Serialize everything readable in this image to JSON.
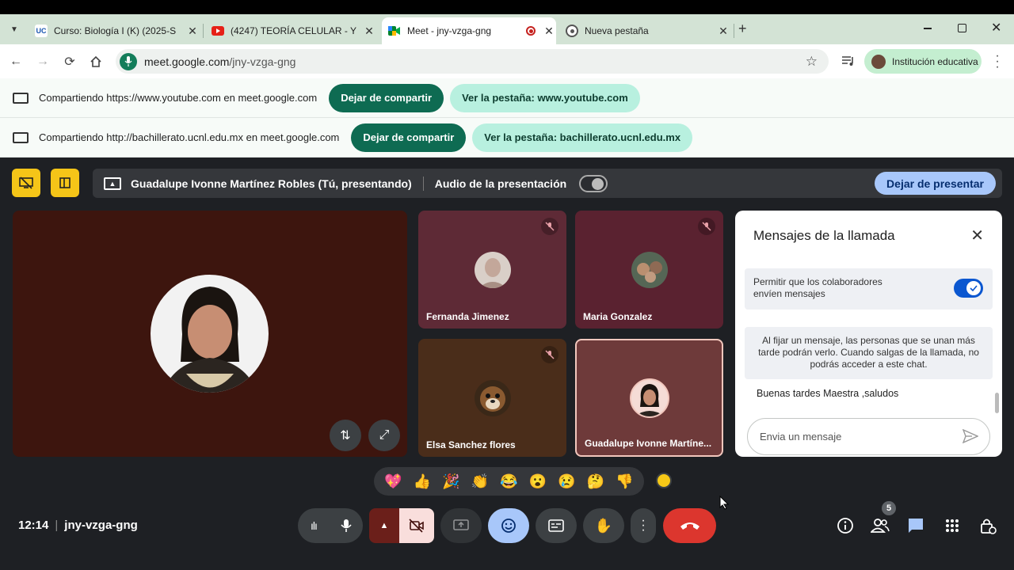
{
  "browser": {
    "tabs": [
      {
        "title": "Curso: Biología I (K) (2025-S",
        "favicon": "uc-logo-icon",
        "active": false
      },
      {
        "title": "(4247) TEORÍA CELULAR - Y",
        "favicon": "youtube-icon",
        "active": false
      },
      {
        "title": "Meet - jny-vzga-gng",
        "favicon": "meet-icon",
        "active": true
      },
      {
        "title": "Nueva pestaña",
        "favicon": "chrome-icon",
        "active": false
      }
    ],
    "url_host": "meet.google.com",
    "url_path": "/jny-vzga-gng",
    "profile_label": "Institución educativa"
  },
  "share_bars": [
    {
      "text": "Compartiendo https://www.youtube.com en meet.google.com",
      "stop_label": "Dejar de compartir",
      "view_label": "Ver la pestaña: www.youtube.com"
    },
    {
      "text": "Compartiendo http://bachillerato.ucnl.edu.mx en meet.google.com",
      "stop_label": "Dejar de compartir",
      "view_label": "Ver la pestaña: bachillerato.ucnl.edu.mx"
    }
  ],
  "meet": {
    "presenter_text": "Guadalupe Ivonne Martínez Robles (Tú, presentando)",
    "audio_label": "Audio de la presentación",
    "stop_presenting_label": "Dejar de presentar",
    "participants": [
      {
        "name": "Fernanda Jimenez",
        "muted": true,
        "bg": "#5e2a36"
      },
      {
        "name": "Maria Gonzalez",
        "muted": true,
        "bg": "#5a2230"
      },
      {
        "name": "Elsa Sanchez flores",
        "muted": true,
        "bg": "#4a2d1a"
      },
      {
        "name": "Guadalupe Ivonne Martíne...",
        "muted": false,
        "bg": "#6e3a3a"
      }
    ],
    "chat": {
      "title": "Mensajes de la llamada",
      "permission_text": "Permitir que los colaboradores envíen mensajes",
      "pin_notice": "Al fijar un mensaje, las personas que se unan más tarde podrán verlo. Cuando salgas de la llamada, no podrás acceder a este chat.",
      "messages": [
        "Buenas tardes Maestra ,saludos"
      ],
      "input_placeholder": "Envia un mensaje"
    },
    "reactions": [
      "💖",
      "👍",
      "🎉",
      "👏",
      "😂",
      "😮",
      "😢",
      "🤔",
      "👎"
    ],
    "time": "12:14",
    "meeting_code": "jny-vzga-gng",
    "participant_count": "5"
  }
}
